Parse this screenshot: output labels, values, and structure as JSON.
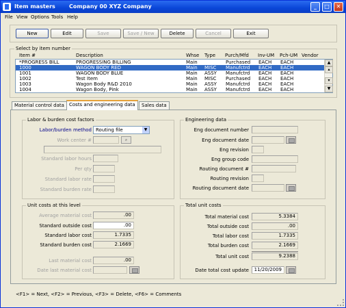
{
  "window": {
    "title": "Item masters",
    "company": "Company 00  XYZ Company",
    "min": "_",
    "max": "□",
    "close": "✕"
  },
  "menu": [
    "File",
    "View",
    "Options",
    "Tools",
    "Help"
  ],
  "toolbar": {
    "new": "New",
    "edit": "Edit",
    "save": "Save",
    "save_new": "Save / New",
    "delete": "Delete",
    "cancel": "Cancel",
    "exit": "Exit"
  },
  "item_list": {
    "group_label": "Select by item number",
    "columns": [
      "Item #",
      "Description",
      "Whse",
      "Type",
      "Purch/Mfd",
      "Inv-UM",
      "Pch-UM",
      "Vendor"
    ],
    "rows": [
      [
        "*PROGRESS BILL",
        "PROGRESSING BILLING",
        "Main",
        "",
        "Purchased",
        "EACH",
        "EACH",
        ""
      ],
      [
        "1000",
        "WAGON BODY RED",
        "Main",
        "MISC",
        "Manufctrd",
        "EACH",
        "EACH",
        ""
      ],
      [
        "1001",
        "WAGON BODY BLUE",
        "Main",
        "ASSY",
        "Manufctrd",
        "EACH",
        "EACH",
        ""
      ],
      [
        "1002",
        "Test Item",
        "Main",
        "MISC",
        "Purchased",
        "EACH",
        "EACH",
        ""
      ],
      [
        "1003",
        "Wagon Body R&D 2010",
        "Main",
        "ASSY",
        "Manufctrd",
        "EACH",
        "EACH",
        ""
      ],
      [
        "1004",
        "Wagon Body, Pink",
        "Main",
        "ASSY",
        "Manufctrd",
        "EACH",
        "EACH",
        ""
      ]
    ],
    "selected_index": 1
  },
  "tabs": [
    "Material control data",
    "Costs and engineering data",
    "Sales data"
  ],
  "active_tab": 1,
  "labor": {
    "group_label": "Labor & burden cost factors",
    "method_label": "Labor/burden method",
    "method_value": "Routing file",
    "work_center_label": "Work center #",
    "std_labor_hours": "Standard labor hours",
    "per_qty": "Per qty",
    "std_labor_rate": "Standard labor rate",
    "std_burden_rate": "Standard burden rate"
  },
  "engineering": {
    "group_label": "Engineering data",
    "eng_doc_number": "Eng document number",
    "eng_doc_date": "Eng document date",
    "eng_revision": "Eng revision",
    "eng_group_code": "Eng group code",
    "routing_doc": "Routing document #",
    "routing_revision": "Routing revision",
    "routing_doc_date": "Routing document date"
  },
  "unit_costs": {
    "group_label": "Unit costs at this level",
    "avg_material_label": "Average material cost",
    "avg_material": ".00",
    "std_outside_label": "Standard outside cost",
    "std_outside": ".00",
    "std_labor_label": "Standard labor cost",
    "std_labor": "1.7335",
    "std_burden_label": "Standard burden cost",
    "std_burden": "2.1669",
    "last_material_label": "Last material cost",
    "last_material": ".00",
    "date_last_material_label": "Date last material cost"
  },
  "total_costs": {
    "group_label": "Total unit costs",
    "material_label": "Total material cost",
    "material": "5.3384",
    "outside_label": "Total outside cost",
    "outside": ".00",
    "labor_label": "Total labor cost",
    "labor": "1.7335",
    "burden_label": "Total burden cost",
    "burden": "2.1669",
    "unit_label": "Total unit cost",
    "unit": "9.2388",
    "date_update_label": "Date total cost update",
    "date_update": "11/20/2009"
  },
  "status_bar": "<F1> = Next, <F2> = Previous, <F3> = Delete, <F6> = Comments"
}
